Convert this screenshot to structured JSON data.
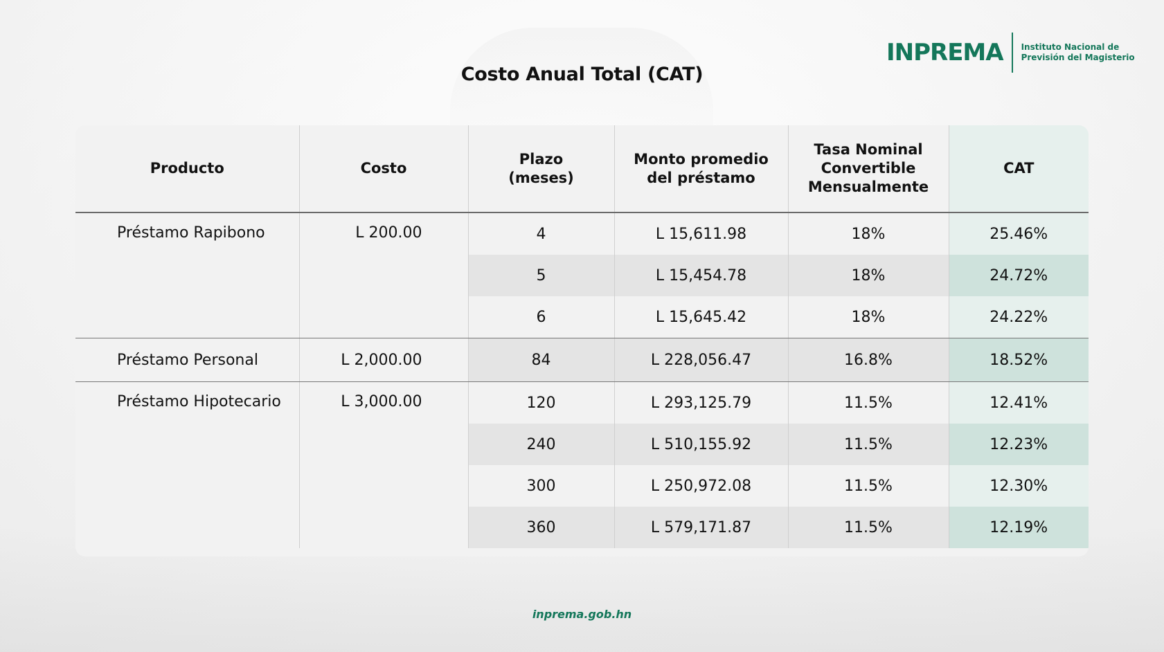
{
  "logo": {
    "wordmark": "INPREMA",
    "subtitle_line1": "Instituto Nacional de",
    "subtitle_line2": "Previsión del Magisterio",
    "color": "#14775a"
  },
  "title": "Costo Anual Total (CAT)",
  "table": {
    "headers": {
      "producto": "Producto",
      "costo": "Costo",
      "plazo_line1": "Plazo",
      "plazo_line2": "(meses)",
      "monto_line1": "Monto promedio",
      "monto_line2": "del préstamo",
      "tasa_line1": "Tasa Nominal",
      "tasa_line2": "Convertible",
      "tasa_line3": "Mensualmente",
      "cat": "CAT"
    },
    "groups": [
      {
        "producto": "Préstamo Rapibono",
        "costo": "L 200.00",
        "rows": [
          {
            "plazo": "4",
            "monto": "L 15,611.98",
            "tasa": "18%",
            "cat": "25.46%"
          },
          {
            "plazo": "5",
            "monto": "L 15,454.78",
            "tasa": "18%",
            "cat": "24.72%"
          },
          {
            "plazo": "6",
            "monto": "L 15,645.42",
            "tasa": "18%",
            "cat": "24.22%"
          }
        ]
      },
      {
        "producto": "Préstamo Personal",
        "costo": "L 2,000.00",
        "rows": [
          {
            "plazo": "84",
            "monto": "L 228,056.47",
            "tasa": "16.8%",
            "cat": "18.52%"
          }
        ]
      },
      {
        "producto": "Préstamo Hipotecario",
        "costo": "L 3,000.00",
        "rows": [
          {
            "plazo": "120",
            "monto": "L 293,125.79",
            "tasa": "11.5%",
            "cat": "12.41%"
          },
          {
            "plazo": "240",
            "monto": "L 510,155.92",
            "tasa": "11.5%",
            "cat": "12.23%"
          },
          {
            "plazo": "300",
            "monto": "L 250,972.08",
            "tasa": "11.5%",
            "cat": "12.30%"
          },
          {
            "plazo": "360",
            "monto": "L 579,171.87",
            "tasa": "11.5%",
            "cat": "12.19%"
          }
        ]
      }
    ]
  },
  "footer": {
    "url": "inprema.gob.hn"
  }
}
